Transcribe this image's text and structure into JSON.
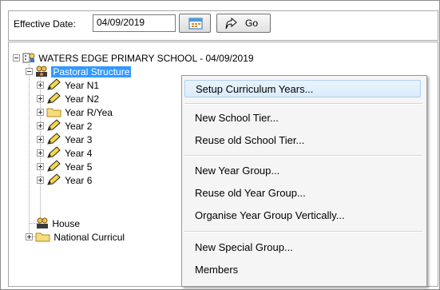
{
  "toolbar": {
    "effective_date_label": "Effective Date:",
    "effective_date_value": "04/09/2019",
    "go_label": "Go"
  },
  "tree": {
    "root_label": "WATERS EDGE PRIMARY SCHOOL - 04/09/2019",
    "pastoral_label": "Pastoral Structure",
    "years": [
      "Year N1",
      "Year N2",
      "Year R/Yea",
      "Year 2",
      "Year 3",
      "Year 4",
      "Year 5",
      "Year 6"
    ],
    "house_label": "House",
    "national_label": "National Curricul"
  },
  "context_menu": {
    "items": [
      "Setup Curriculum Years...",
      "New School Tier...",
      "Reuse old School Tier...",
      "New Year Group...",
      "Reuse old Year Group...",
      "Organise Year Group Vertically...",
      "New Special Group...",
      "Members"
    ]
  }
}
